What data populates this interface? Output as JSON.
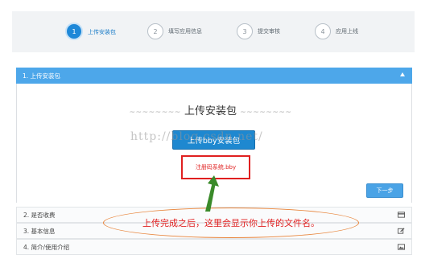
{
  "stepper": {
    "steps": [
      {
        "num": "1",
        "label": "上传安装包"
      },
      {
        "num": "2",
        "label": "填写应用信息"
      },
      {
        "num": "3",
        "label": "提交审核"
      },
      {
        "num": "4",
        "label": "应用上线"
      }
    ],
    "active_index": 0
  },
  "panel": {
    "title": "1. 上传安装包",
    "upload_heading": "上传安装包",
    "upload_button": "上传bby安装包",
    "uploaded_filename": "注册码系统.bby",
    "next_button": "下一步"
  },
  "sections": [
    {
      "label": "2. 是否收费",
      "icon": "card-icon"
    },
    {
      "label": "3. 基本信息",
      "icon": "edit-icon"
    },
    {
      "label": "4. 简介/使用介绍",
      "icon": "image-icon"
    }
  ],
  "annotation": {
    "text": "上传完成之后，这里会显示你上传的文件名。"
  },
  "watermark": "http://blog.csdn.net/",
  "colors": {
    "accent": "#1e88d8",
    "panel_header": "#4da7ea",
    "highlight_red": "#e02020",
    "callout_orange": "#e8843a",
    "arrow_green": "#3a8a2a"
  }
}
